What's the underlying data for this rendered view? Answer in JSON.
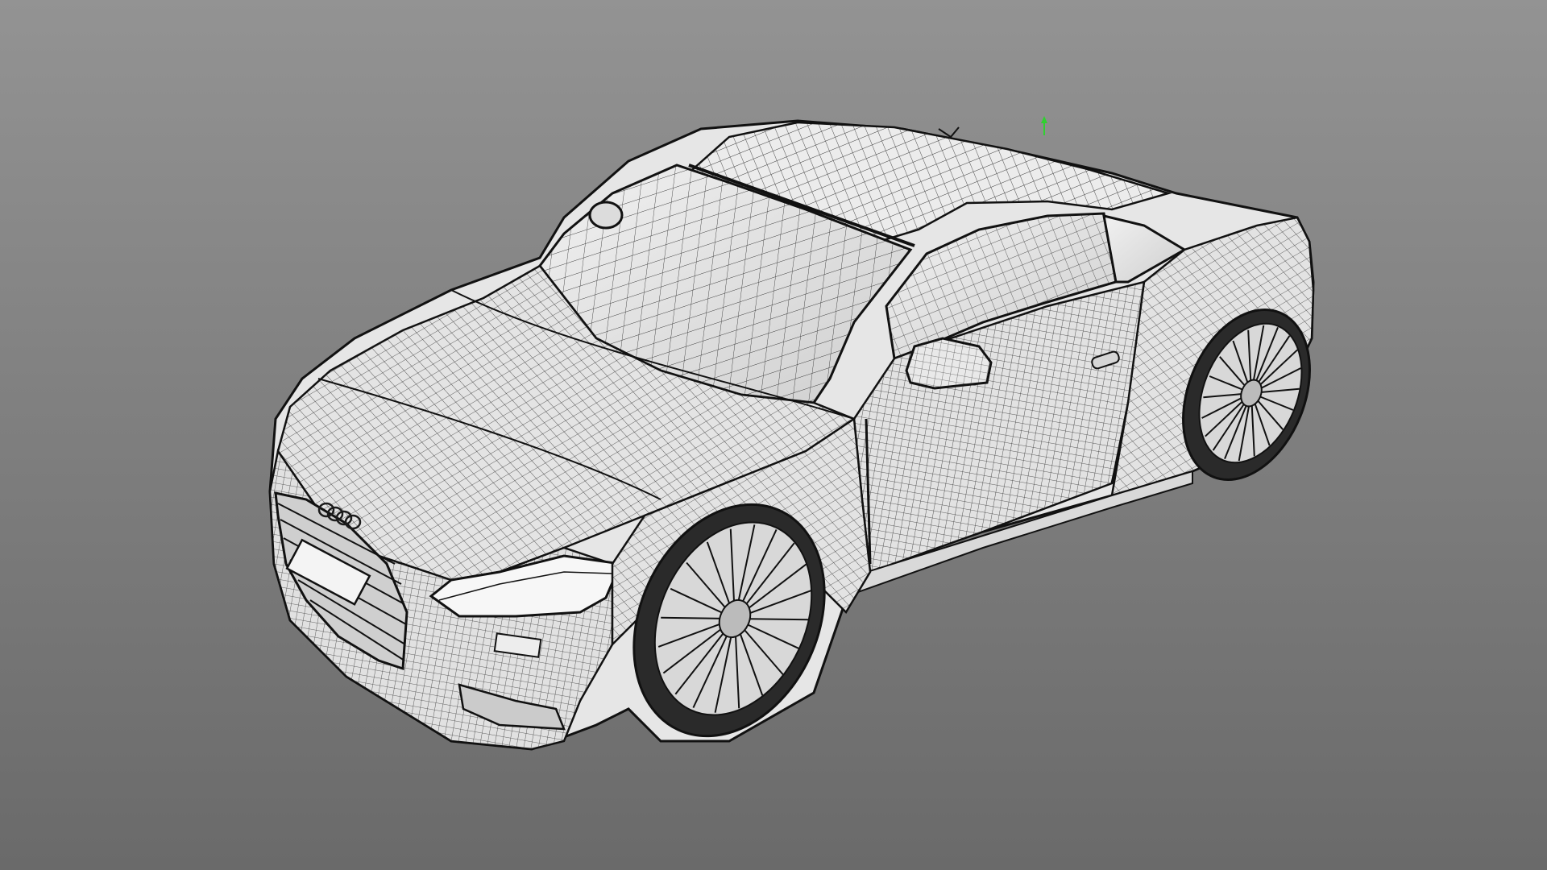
{
  "viewport": {
    "background_top": "#939393",
    "background_bottom": "#6a6a6a",
    "model_fill": "#e9e9e9",
    "model_shadow": "#c8c8c8",
    "wire_color": "#1c1c1c",
    "gizmo_color": "#2fd12f"
  },
  "model": {
    "logo_rings": 4
  }
}
